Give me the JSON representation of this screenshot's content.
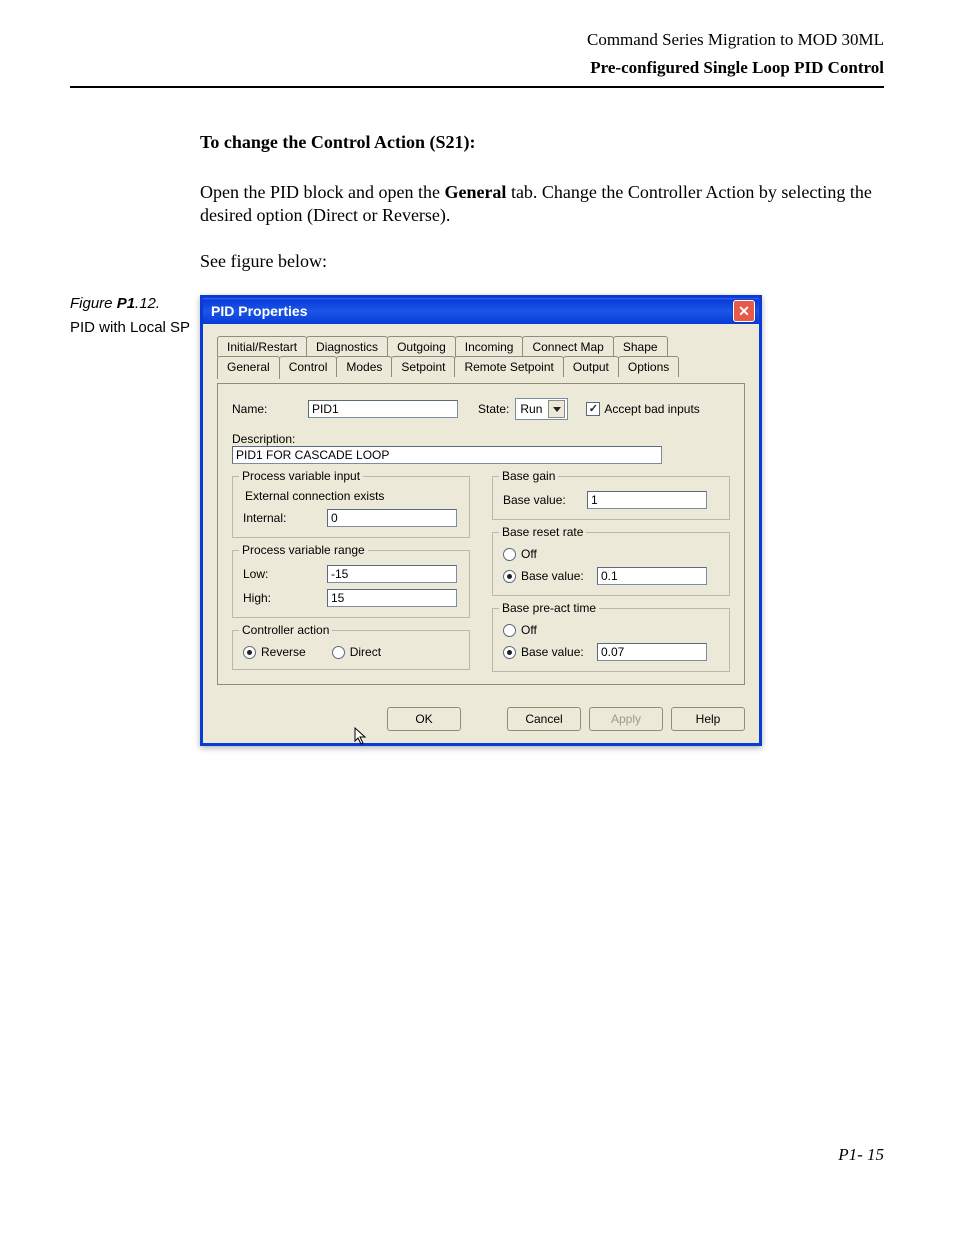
{
  "header": {
    "title": "Command Series Migration to MOD 30ML",
    "subtitle": "Pre-configured Single Loop PID Control"
  },
  "figure": {
    "label_prefix": "Figure ",
    "label_bold": "P1",
    "label_suffix": ".12.",
    "caption": "PID with Local SP"
  },
  "instructions": {
    "heading": "To change the Control Action (S21):",
    "para1_a": "Open the PID block and open the ",
    "para1_bold": "General",
    "para1_b": " tab. Change the Controller Action by selecting the desired option (Direct or Reverse).",
    "para2": "See figure below:"
  },
  "dialog": {
    "title": "PID Properties",
    "tabs_row1": [
      "Initial/Restart",
      "Diagnostics",
      "Outgoing",
      "Incoming",
      "Connect Map",
      "Shape"
    ],
    "tabs_row2": [
      "General",
      "Control",
      "Modes",
      "Setpoint",
      "Remote Setpoint",
      "Output",
      "Options"
    ],
    "active_tab": "General",
    "name_label": "Name:",
    "name_value": "PID1",
    "state_label": "State:",
    "state_value": "Run",
    "accept_label": "Accept bad inputs",
    "desc_label": "Description:",
    "desc_value": "PID1 FOR CASCADE LOOP",
    "pvi": {
      "legend": "Process variable input",
      "subtext": "External connection exists",
      "internal_label": "Internal:",
      "internal_value": "0"
    },
    "pvr": {
      "legend": "Process variable range",
      "low_label": "Low:",
      "low_value": "-15",
      "high_label": "High:",
      "high_value": "15"
    },
    "ca": {
      "legend": "Controller action",
      "reverse": "Reverse",
      "direct": "Direct"
    },
    "bg": {
      "legend": "Base gain",
      "label": "Base value:",
      "value": "1"
    },
    "brr": {
      "legend": "Base reset rate",
      "off": "Off",
      "label": "Base value:",
      "value": "0.1"
    },
    "bpt": {
      "legend": "Base pre-act time",
      "off": "Off",
      "label": "Base value:",
      "value": "0.07"
    },
    "buttons": {
      "ok": "OK",
      "cancel": "Cancel",
      "apply": "Apply",
      "help": "Help"
    }
  },
  "footer": "P1- 15"
}
